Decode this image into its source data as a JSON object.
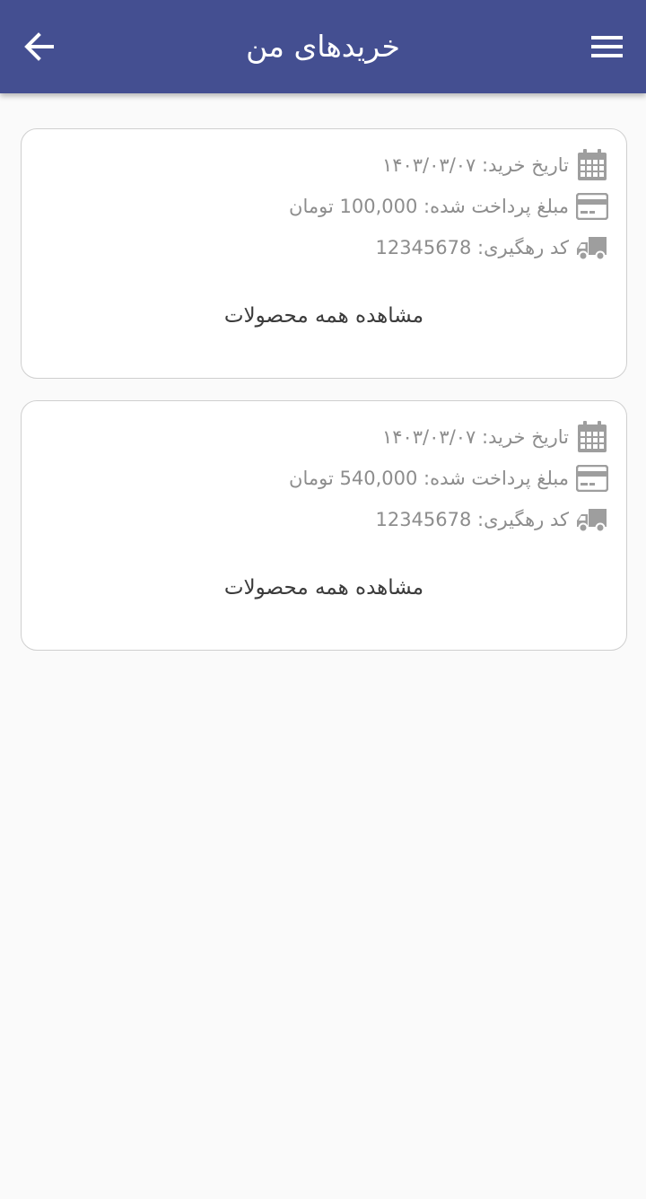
{
  "header": {
    "title": "خریدهای من",
    "back_icon": "arrow-left-icon",
    "menu_icon": "hamburger-menu-icon",
    "background": "#444f91"
  },
  "orders": [
    {
      "date_label": "تاریخ خرید:",
      "date_value": "۱۴۰۳/۰۳/۰۷",
      "amount_label": "مبلغ پرداخت شده:",
      "amount_value": "100,000",
      "currency": "تومان",
      "tracking_label": "کد رهگیری:",
      "tracking_value": "12345678",
      "view_all_label": "مشاهده همه محصولات"
    },
    {
      "date_label": "تاریخ خرید:",
      "date_value": "۱۴۰۳/۰۳/۰۷",
      "amount_label": "مبلغ پرداخت شده:",
      "amount_value": "540,000",
      "currency": "تومان",
      "tracking_label": "کد رهگیری:",
      "tracking_value": "12345678",
      "view_all_label": "مشاهده همه محصولات"
    }
  ],
  "icons": {
    "date": "calendar-icon",
    "amount": "credit-card-icon",
    "tracking": "delivery-truck-icon"
  },
  "colors": {
    "card_border": "#cfcfcf",
    "secondary_text": "#8d8d8d",
    "primary_text": "#3b3b3b",
    "icon": "#9e9e9e"
  }
}
